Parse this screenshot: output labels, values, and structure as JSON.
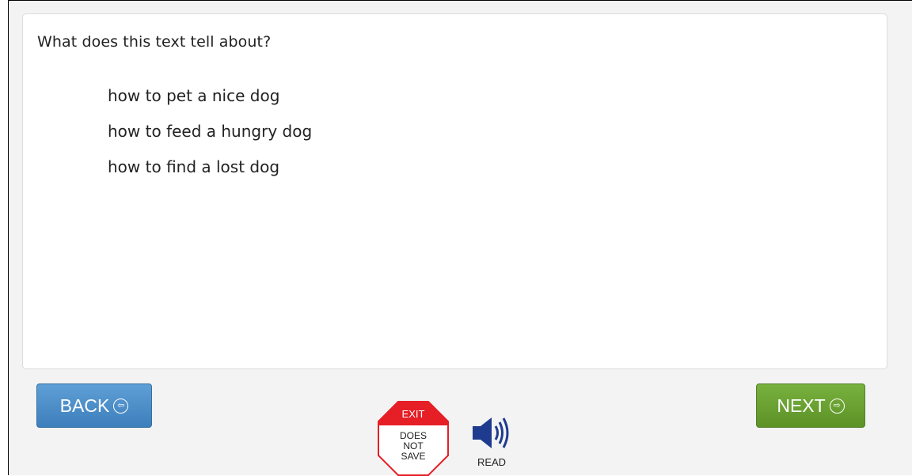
{
  "question": "What does this text tell about?",
  "options": [
    "how to pet a nice dog",
    "how to feed a hungry dog",
    "how to find a lost dog"
  ],
  "buttons": {
    "back": "BACK",
    "next": "NEXT"
  },
  "exit": {
    "title": "EXIT",
    "line1": "DOES",
    "line2": "NOT",
    "line3": "SAVE"
  },
  "read_label": "READ",
  "colors": {
    "back": "#4a8cc7",
    "next": "#6aa232",
    "exit_red": "#e61e26",
    "speaker": "#1f3b8f"
  },
  "icons": {
    "back": "left-arrow-circle-icon",
    "next": "right-arrow-circle-icon",
    "exit": "stop-sign-icon",
    "read": "speaker-icon"
  }
}
